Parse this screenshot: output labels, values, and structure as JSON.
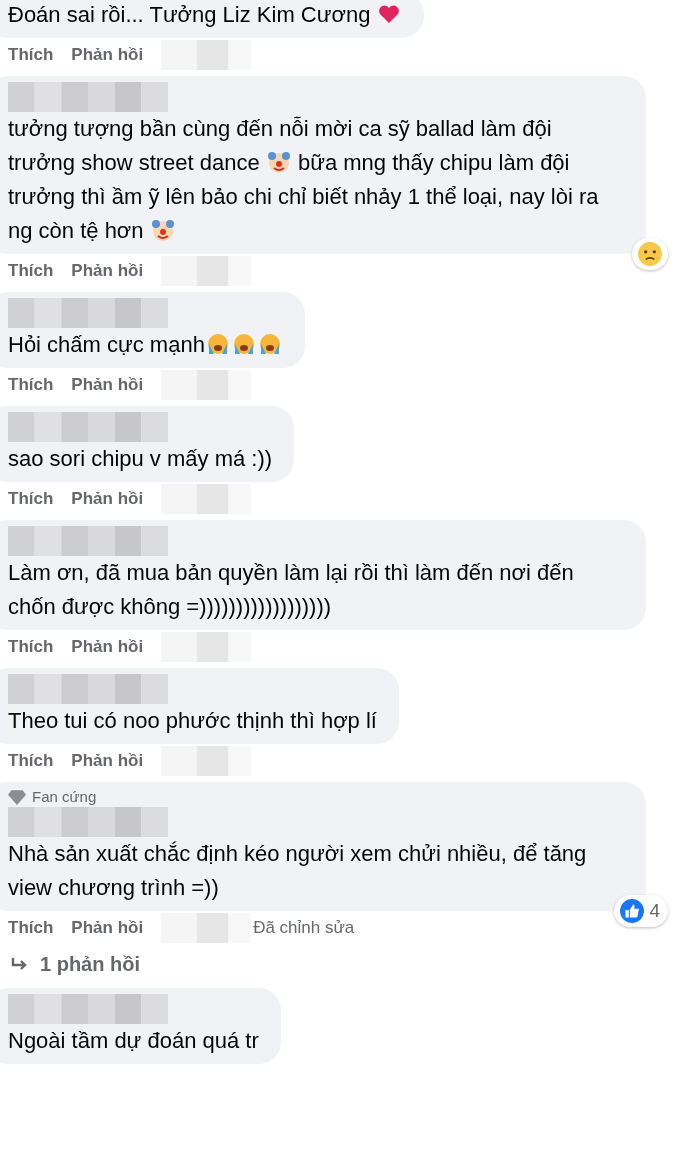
{
  "comments": [
    {
      "name_blurred": false,
      "parts": [
        {
          "kind": "text",
          "text": "Đoán sai rồi... Tưởng Liz Kim Cương "
        },
        {
          "kind": "heart"
        }
      ],
      "actions": [
        "Thích",
        "Phản hồi"
      ]
    },
    {
      "name_blurred": true,
      "parts": [
        {
          "kind": "text",
          "text": "tưởng tượng bần cùng đến nỗi mời ca sỹ ballad làm đội trưởng show street dance "
        },
        {
          "kind": "clown"
        },
        {
          "kind": "text",
          "text": " bữa mng thấy chipu làm đội trưởng thì ầm ỹ lên bảo chi chỉ biết nhảy 1 thể loại, nay lòi ra ng còn tệ hơn "
        },
        {
          "kind": "clown"
        }
      ],
      "reaction": {
        "kind": "sad"
      },
      "actions": [
        "Thích",
        "Phản hồi"
      ]
    },
    {
      "name_blurred": true,
      "parts": [
        {
          "kind": "text",
          "text": "Hỏi chấm cực mạnh"
        },
        {
          "kind": "crying"
        },
        {
          "kind": "crying"
        },
        {
          "kind": "crying"
        }
      ],
      "actions": [
        "Thích",
        "Phản hồi"
      ]
    },
    {
      "name_blurred": true,
      "parts": [
        {
          "kind": "text",
          "text": "sao sori chipu v mấy má :))"
        }
      ],
      "actions": [
        "Thích",
        "Phản hồi"
      ]
    },
    {
      "name_blurred": true,
      "parts": [
        {
          "kind": "text",
          "text": "Làm ơn, đã mua bản quyền làm lại rồi thì làm đến nơi đến chốn được không =))))))))))))))))))"
        }
      ],
      "actions": [
        "Thích",
        "Phản hồi"
      ]
    },
    {
      "name_blurred": true,
      "parts": [
        {
          "kind": "text",
          "text": "Theo tui có noo phước thịnh thì hợp lí"
        }
      ],
      "actions": [
        "Thích",
        "Phản hồi"
      ]
    },
    {
      "badge": "Fan cứng",
      "name_blurred": true,
      "parts": [
        {
          "kind": "text",
          "text": "Nhà sản xuất chắc định kéo người xem chửi nhiều, để tăng view chương trình =))"
        }
      ],
      "reaction": {
        "kind": "like",
        "count": "4"
      },
      "actions": [
        "Thích",
        "Phản hồi"
      ],
      "edited": "Đã chỉnh sửa",
      "replies": "1 phản hồi"
    },
    {
      "name_blurred": true,
      "parts": [
        {
          "kind": "text",
          "text": "Ngoài tầm dự đoán quá tr"
        }
      ]
    }
  ]
}
